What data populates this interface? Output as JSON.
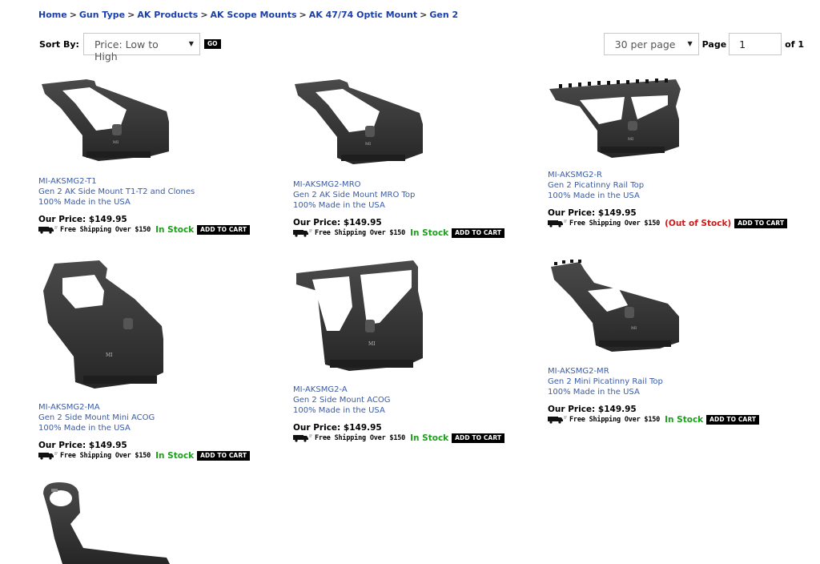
{
  "breadcrumb": [
    {
      "label": "Home"
    },
    {
      "label": "Gun Type"
    },
    {
      "label": "AK Products"
    },
    {
      "label": "AK Scope Mounts"
    },
    {
      "label": "AK 47/74 Optic Mount"
    },
    {
      "label": "Gen 2"
    }
  ],
  "breadcrumb_separator": ">",
  "sort": {
    "label": "Sort By:",
    "value": "Price: Low to High",
    "go_label": "GO"
  },
  "paging": {
    "per_page": "30 per page",
    "page_label": "Page",
    "page_value": "1",
    "of_label": "of 1"
  },
  "products": [
    {
      "sku": "MI-AKSMG2-T1",
      "name": "Gen 2 AK Side Mount T1-T2 and Clones",
      "origin": "100% Made in the USA",
      "price": "Our Price: $149.95",
      "shipping": "Free Shipping Over $150",
      "stock": "In Stock",
      "cart": "ADD TO CART",
      "icon": "side-mount-t1"
    },
    {
      "sku": "MI-AKSMG2-MRO",
      "name": "Gen 2 AK Side Mount MRO Top",
      "origin": "100% Made in the USA",
      "price": "Our Price: $149.95",
      "shipping": "Free Shipping Over $150",
      "stock": "In Stock",
      "cart": "ADD TO CART",
      "icon": "side-mount-mro"
    },
    {
      "sku": "MI-AKSMG2-R",
      "name": "Gen 2 Picatinny Rail Top",
      "origin": "100% Made in the USA",
      "price": "Our Price: $149.95",
      "shipping": "Free Shipping Over $150",
      "stock": "(Out of Stock)",
      "cart": "ADD TO CART",
      "icon": "side-mount-rail"
    },
    {
      "sku": "MI-AKSMG2-MA",
      "name": "Gen 2 Side Mount Mini ACOG",
      "origin": "100% Made in the USA",
      "price": "Our Price: $149.95",
      "shipping": "Free Shipping Over $150",
      "stock": "In Stock",
      "cart": "ADD TO CART",
      "icon": "side-mount-mini-acog"
    },
    {
      "sku": "MI-AKSMG2-A",
      "name": "Gen 2 Side Mount ACOG",
      "origin": "100% Made in the USA",
      "price": "Our Price: $149.95",
      "shipping": "Free Shipping Over $150",
      "stock": "In Stock",
      "cart": "ADD TO CART",
      "icon": "side-mount-acog"
    },
    {
      "sku": "MI-AKSMG2-MR",
      "name": "Gen 2 Mini Picatinny Rail Top",
      "origin": "100% Made in the USA",
      "price": "Our Price: $149.95",
      "shipping": "Free Shipping Over $150",
      "stock": "In Stock",
      "cart": "ADD TO CART",
      "icon": "side-mount-mini-rail"
    },
    {
      "icon": "side-mount-ring"
    }
  ],
  "colors": {
    "link": "#1a3fa8",
    "desc": "#3a5ba8",
    "in_stock": "#1aa01a",
    "out_of_stock": "#d01818",
    "button": "#000000"
  }
}
